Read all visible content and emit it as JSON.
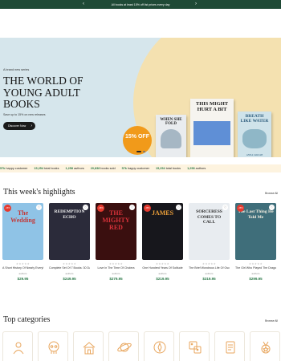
{
  "announcement": {
    "text": "All books at least 15% off list prices every day",
    "prev_icon": "chevron-left-icon",
    "next_icon": "chevron-right-icon"
  },
  "hero": {
    "eyebrow": "A brand new series",
    "title": "THE WORLD OF YOUNG ADULT BOOKS",
    "subtitle": "Save up to 15% on new releases",
    "cta_label": "Discover Now",
    "discount_badge": "15% OFF",
    "books": [
      {
        "title": "WHEN SHE FOLD"
      },
      {
        "title": "THIS MIGHT HURT A BIT"
      },
      {
        "title": "BREATH LIKE WATER",
        "author": "ANNA JARZAB"
      }
    ],
    "slider_dots": 2,
    "slider_active": 0,
    "colors": {
      "background": "#d6e6ec",
      "blob": "#f4e1b0",
      "badge": "#f19a1a"
    }
  },
  "ticker": [
    {
      "num": "57k",
      "label": "happy customer"
    },
    {
      "num": "15,254",
      "label": "total books"
    },
    {
      "num": "1,258",
      "label": "authors"
    },
    {
      "num": "20,838",
      "label": "books sold"
    },
    {
      "num": "57k",
      "label": "happy customer"
    },
    {
      "num": "15,254",
      "label": "total books"
    },
    {
      "num": "1,258",
      "label": "authors"
    }
  ],
  "highlights": {
    "title": "This week's highlights",
    "browse_label": "Browse All",
    "items": [
      {
        "cover_text": "The Wedding",
        "cover_color": "#8fc3e6",
        "text_color": "#c23b3b",
        "sale": "-15%",
        "name": "A Short History Of Nearly Everything",
        "author": "authors",
        "price": "$29.95"
      },
      {
        "cover_text": "REDEMPTION ECHO",
        "cover_color": "#2b2b3a",
        "text_color": "#f5f5f5",
        "sale": "",
        "name": "Complete Set Of 7 Books: 30 Days To Change...",
        "author": "authors",
        "price": "$249.95"
      },
      {
        "cover_text": "THE MIGHTY RED",
        "cover_color": "#3a0f0f",
        "text_color": "#d8323a",
        "sale": "-15%",
        "name": "Love In The Time Of Cholera",
        "author": "authors",
        "price": "$279.95"
      },
      {
        "cover_text": "JAMES",
        "cover_color": "#17171c",
        "text_color": "#f0a23a",
        "sale": "-15%",
        "name": "One Hundred Years Of Solitude",
        "author": "authors",
        "price": "$219.95"
      },
      {
        "cover_text": "SORCERESS COMES TO CALL",
        "cover_color": "#e8ecf0",
        "text_color": "#2b2b2b",
        "sale": "",
        "name": "The Brief Wondrous Life Of Oscar Wao",
        "author": "authors",
        "price": "$319.95"
      },
      {
        "cover_text": "The Last Thing He Told Me",
        "cover_color": "#3f6e7a",
        "text_color": "#f7f0e2",
        "sale": "-15%",
        "name": "The Girl Who Played The Dragon Tattoo",
        "author": "authors",
        "price": "$299.95"
      }
    ]
  },
  "categories": {
    "title": "Top categories",
    "browse_label": "Browse All",
    "items": [
      {
        "icon": "baby-icon"
      },
      {
        "icon": "skull-icon"
      },
      {
        "icon": "house-icon"
      },
      {
        "icon": "planet-icon"
      },
      {
        "icon": "compass-icon"
      },
      {
        "icon": "dice-icon"
      },
      {
        "icon": "scroll-icon"
      },
      {
        "icon": "medal-icon"
      }
    ],
    "accent": "#e8a55c"
  },
  "card_rating_icon": "star-icon"
}
